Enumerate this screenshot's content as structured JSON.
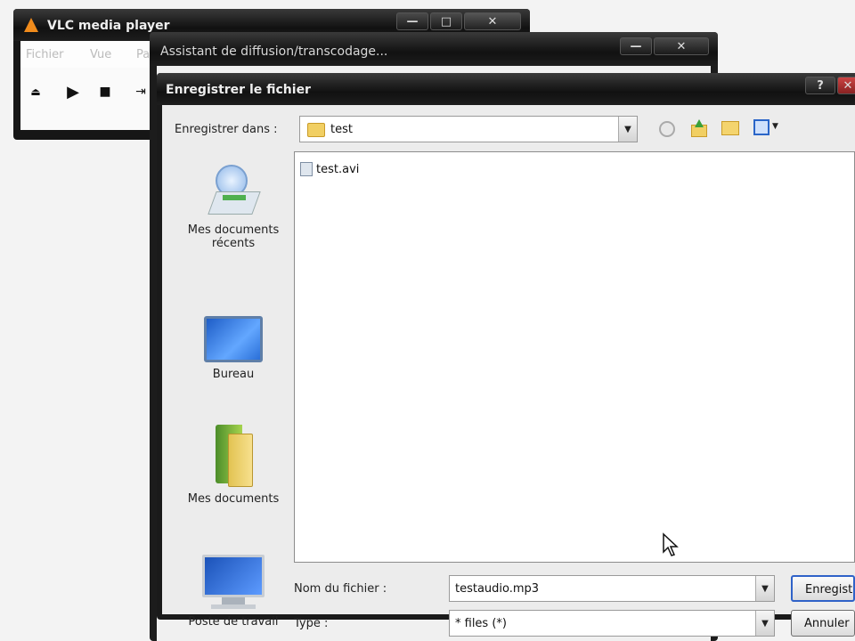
{
  "vlc": {
    "title": "VLC media player",
    "menu": [
      "Fichier",
      "Vue",
      "Para"
    ],
    "buttons": {
      "minimize": "—",
      "maximize": "□",
      "close": "✕"
    }
  },
  "assistant": {
    "title": "Assistant de diffusion/transcodage...",
    "buttons": {
      "minimize": "—",
      "close": "✕"
    }
  },
  "save_dialog": {
    "title": "Enregistrer le fichier",
    "save_in_label": "Enregistrer dans :",
    "save_in_value": "test",
    "places": [
      {
        "label": "Mes documents récents",
        "icon": "recent-documents-icon"
      },
      {
        "label": "Bureau",
        "icon": "desktop-icon"
      },
      {
        "label": "Mes documents",
        "icon": "my-documents-icon"
      },
      {
        "label": "Poste de travail",
        "icon": "my-computer-icon"
      }
    ],
    "files": [
      {
        "name": "test.avi",
        "icon": "video-file-icon"
      }
    ],
    "filename_label": "Nom du fichier :",
    "filename_value": "testaudio.mp3",
    "type_label": "Type :",
    "type_value": "* files (*)",
    "save_button": "Enregistrer",
    "cancel_button": "Annuler"
  }
}
